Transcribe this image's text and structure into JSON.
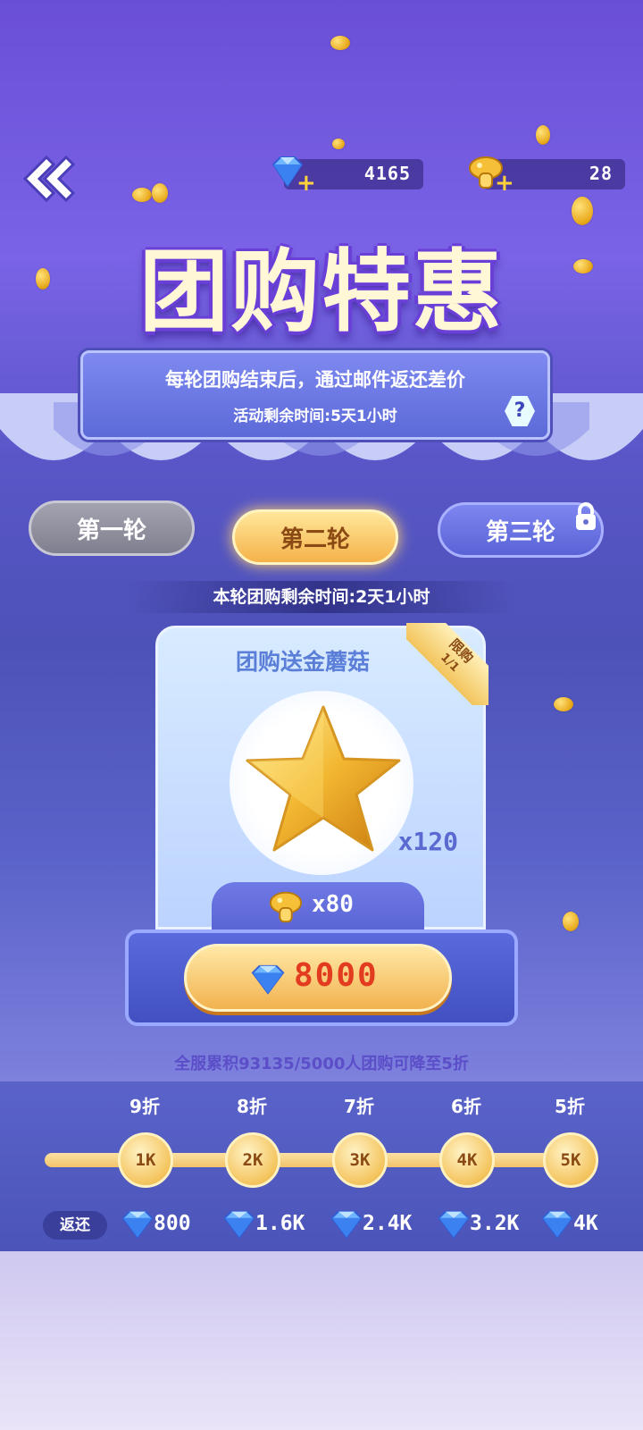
{
  "header": {
    "gems": "4165",
    "mushrooms": "28"
  },
  "title": "团购特惠",
  "info": {
    "line1": "每轮团购结束后，通过邮件返还差价",
    "line2": "活动剩余时间:5天1小时",
    "help": "?"
  },
  "rounds": [
    {
      "label": "第一轮",
      "state": "completed"
    },
    {
      "label": "第二轮",
      "state": "active"
    },
    {
      "label": "第三轮",
      "state": "locked"
    }
  ],
  "round_remaining": "本轮团购剩余时间:2天1小时",
  "card": {
    "title": "团购送金蘑菇",
    "limit_label": "限购",
    "limit_count": "1/1",
    "item_icon": "gold-star-icon",
    "item_qty": "x120",
    "bonus_qty": "x80"
  },
  "buy": {
    "price": "8000"
  },
  "progress_text": "全服累积93135/5000人团购可降至5折",
  "discounts": [
    {
      "label": "9折",
      "node": "1K",
      "return": "800"
    },
    {
      "label": "8折",
      "node": "2K",
      "return": "1.6K"
    },
    {
      "label": "7折",
      "node": "3K",
      "return": "2.4K"
    },
    {
      "label": "6折",
      "node": "4K",
      "return": "3.2K"
    },
    {
      "label": "5折",
      "node": "5K",
      "return": "4K"
    }
  ],
  "return_label": "返还",
  "colors": {
    "accent_gold": "#f2b24f",
    "price_red": "#e23b1f",
    "panel_blue": "#5a6adc"
  }
}
